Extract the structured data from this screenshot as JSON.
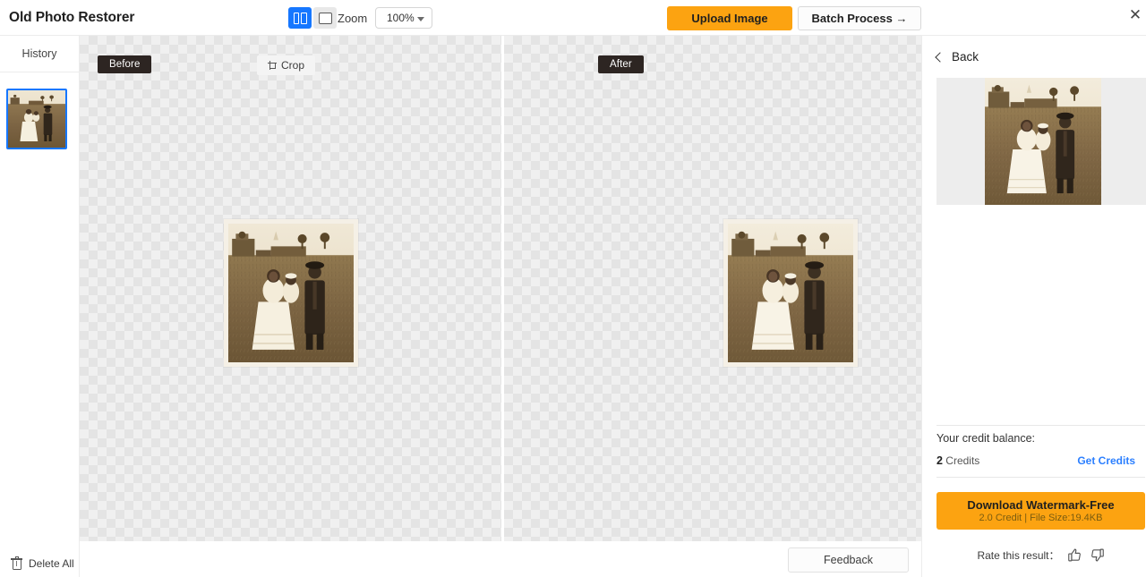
{
  "app": {
    "title": "Old Photo Restorer"
  },
  "toolbar": {
    "view_split_icon": "split-view-icon",
    "view_single_icon": "single-view-icon",
    "zoom_label": "Zoom",
    "zoom_value": "100%",
    "zoom_options": [
      "100%"
    ],
    "upload_label": "Upload Image",
    "batch_label": "Batch Process →",
    "close_icon": "close-icon",
    "accent_orange": "#fca311",
    "accent_blue": "#1677ff"
  },
  "sidebar": {
    "header": "History",
    "thumbnail_alt": "restored-photo-thumbnail",
    "delete_all_label": "Delete All",
    "delete_icon": "trash-icon"
  },
  "canvas": {
    "before_tag": "Before",
    "after_tag": "After",
    "crop_label": "Crop",
    "crop_icon": "crop-icon"
  },
  "bottom": {
    "feedback_label": "Feedback"
  },
  "right": {
    "back_label": "Back",
    "back_icon": "chevron-left-icon",
    "preview_alt": "restored-photo-preview",
    "credit_balance_label": "Your credit balance:",
    "credit_amount": "2",
    "credit_unit": "Credits",
    "get_credits_label": "Get Credits",
    "download_label": "Download Watermark-Free",
    "download_sub": "2.0 Credit | File Size:19.4KB",
    "rate_label": "Rate this result：",
    "thumbs_up_icon": "thumbs-up-icon",
    "thumbs_down_icon": "thumbs-down-icon",
    "link_color": "#2b7fff"
  }
}
